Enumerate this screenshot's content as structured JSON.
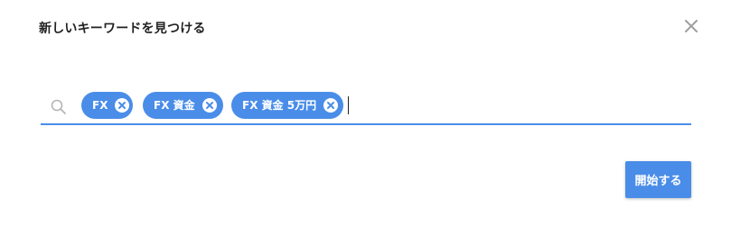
{
  "dialog": {
    "title": "新しいキーワードを見つける",
    "close_icon": "close-icon"
  },
  "search": {
    "icon": "search-icon",
    "value": "",
    "chips": [
      {
        "label": "FX"
      },
      {
        "label": "FX 資金"
      },
      {
        "label": "FX 資金 5万円"
      }
    ]
  },
  "actions": {
    "start_label": "開始する"
  },
  "colors": {
    "accent": "#4a8de8",
    "title_text": "#222222",
    "icon_gray": "#9e9e9e"
  }
}
